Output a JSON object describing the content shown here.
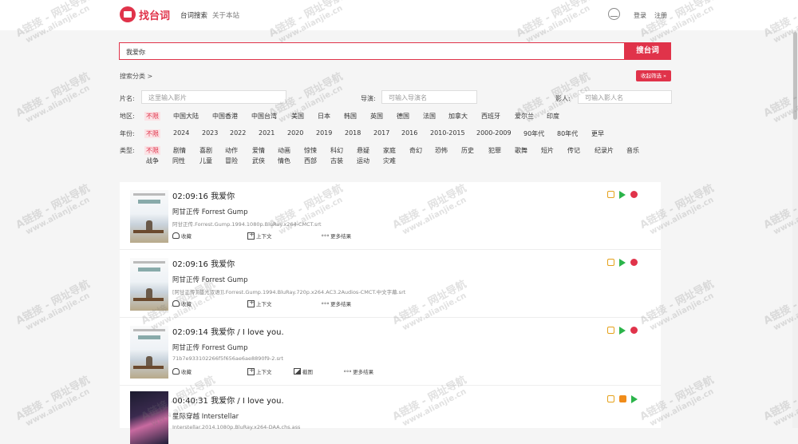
{
  "header": {
    "logo_text": "找台词",
    "nav": [
      "台词搜索",
      "关于本站"
    ],
    "login": "登录",
    "register": "注册"
  },
  "search": {
    "value": "我爱你",
    "button": "搜台词"
  },
  "filters": {
    "crumb": "搜索分类 >",
    "collapse": "收起筛选 »",
    "title_label": "片名:",
    "title_placeholder": "这里输入影片",
    "director_label": "导演:",
    "director_placeholder": "可输入导演名",
    "actor_label": "影人:",
    "actor_placeholder": "可输入影人名",
    "region_label": "地区:",
    "regions": [
      "不限",
      "中国大陆",
      "中国香港",
      "中国台湾",
      "美国",
      "日本",
      "韩国",
      "英国",
      "德国",
      "法国",
      "加拿大",
      "西班牙",
      "爱尔兰",
      "印度"
    ],
    "year_label": "年份:",
    "years": [
      "不限",
      "2024",
      "2023",
      "2022",
      "2021",
      "2020",
      "2019",
      "2018",
      "2017",
      "2016",
      "2010-2015",
      "2000-2009",
      "90年代",
      "80年代",
      "更早"
    ],
    "genre_label": "类型:",
    "genres_row1": [
      "不限",
      "剧情",
      "喜剧",
      "动作",
      "爱情",
      "动画",
      "惊悚",
      "科幻",
      "悬疑",
      "家庭",
      "奇幻",
      "恐怖",
      "历史",
      "犯罪",
      "歌舞",
      "短片",
      "传记",
      "纪录片",
      "音乐"
    ],
    "genres_row2": [
      "战争",
      "同性",
      "儿童",
      "冒险",
      "武侠",
      "情色",
      "西部",
      "古装",
      "运动",
      "灾难"
    ]
  },
  "results": [
    {
      "time": "02:09:16 我爱你",
      "movie": "阿甘正传 Forrest Gump",
      "file": "阿甘正传.Forrest.Gump.1994.1080p.BluRay.x264-CMCT.srt",
      "actions": [
        "收藏",
        "上下文",
        "更多结果"
      ]
    },
    {
      "time": "02:09:16 我爱你",
      "movie": "阿甘正传 Forrest Gump",
      "file": "[阿甘正传][蓝光双语]].Forrest.Gump.1994.BluRay.720p.x264.AC3.2Audios-CMCT.中文字幕.srt",
      "actions": [
        "收藏",
        "上下文",
        "更多结果"
      ]
    },
    {
      "time": "02:09:14 我爱你 / I love you.",
      "movie": "阿甘正传 Forrest Gump",
      "file": "71b7e933102266f5f656ae6ae8890f9-2.srt",
      "actions": [
        "收藏",
        "上下文",
        "截图",
        "更多结果"
      ]
    },
    {
      "time": "00:40:31 我爱你 / I love you.",
      "movie": "星际穿越 Interstellar",
      "file": "Interstellar.2014.1080p.BluRay.x264-DAA.chs.ass",
      "actions": []
    }
  ],
  "watermark": {
    "line1": "A链接 - 网址导航",
    "line2": "www.alianjie.cn"
  }
}
